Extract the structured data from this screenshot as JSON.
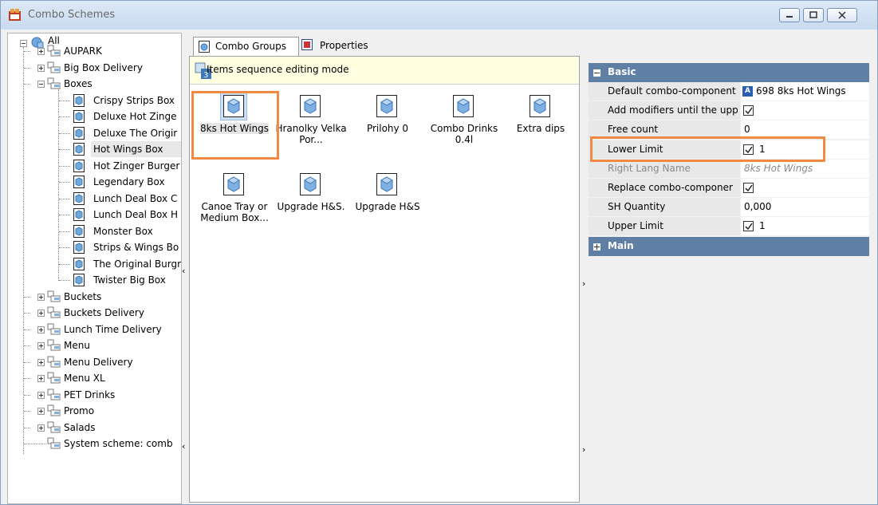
{
  "window": {
    "title": "Combo Schemes",
    "controls": [
      "minimize",
      "maximize",
      "close"
    ]
  },
  "tree": {
    "root": "All",
    "groups_before": [
      "AUPARK",
      "Big Box Delivery"
    ],
    "expanded_group": "Boxes",
    "boxes_children": [
      "Crispy Strips Box",
      "Deluxe Hot Zinge",
      "Deluxe The Origir",
      "Hot Wings Box",
      "Hot Zinger Burger",
      "Legendary Box",
      "Lunch Deal Box C",
      "Lunch Deal Box H",
      "Monster Box",
      "Strips & Wings Bo",
      "The Original Burgr",
      "Twister Big Box"
    ],
    "selected_child": "Hot Wings Box",
    "groups_after": [
      "Buckets",
      "Buckets Delivery",
      "Lunch Time Delivery",
      "Menu",
      "Menu Delivery",
      "Menu XL",
      "PET Drinks",
      "Promo",
      "Salads"
    ],
    "last_item": "System scheme: comb"
  },
  "tabs": [
    {
      "label": "Combo Groups",
      "icon": "combo-group-icon",
      "active": true
    },
    {
      "label": "Properties",
      "icon": "properties-icon",
      "active": false
    }
  ],
  "sequence_bar": {
    "label": "Items sequence editing mode",
    "badge": "3"
  },
  "items": [
    {
      "label": "8ks Hot Wings",
      "selected": true
    },
    {
      "label": "Hranolky Velka Por...",
      "selected": false
    },
    {
      "label": "Prilohy 0",
      "selected": false
    },
    {
      "label": "Combo Drinks 0.4l",
      "selected": false
    },
    {
      "label": "Extra dips",
      "selected": false
    },
    {
      "label": "Canoe Tray or Medium Box...",
      "selected": false
    },
    {
      "label": "Upgrade H&S.",
      "selected": false
    },
    {
      "label": "Upgrade H&S",
      "selected": false
    }
  ],
  "properties": {
    "basic_label": "Basic",
    "main_label": "Main",
    "rows": [
      {
        "name": "Default combo-component",
        "value": "698 8ks Hot Wings",
        "badge": "A",
        "checkbox": null,
        "disabled": false
      },
      {
        "name": "Add modifiers until the upp",
        "value": "",
        "checkbox": true,
        "disabled": false
      },
      {
        "name": "Free count",
        "value": "0",
        "checkbox": null,
        "disabled": false
      },
      {
        "name": "Lower Limit",
        "value": "1",
        "checkbox": true,
        "disabled": false
      },
      {
        "name": "Right Lang Name",
        "value": "8ks Hot Wings",
        "checkbox": null,
        "disabled": true
      },
      {
        "name": "Replace combo-componer",
        "value": "",
        "checkbox": true,
        "disabled": false
      },
      {
        "name": "SH Quantity",
        "value": "0,000",
        "checkbox": null,
        "disabled": false
      },
      {
        "name": "Upper Limit",
        "value": "1",
        "checkbox": true,
        "disabled": false
      }
    ]
  },
  "colors": {
    "accent": "#f08a45",
    "category_header": "#5f7fa5",
    "tooltip_bar": "#ffffe1"
  }
}
